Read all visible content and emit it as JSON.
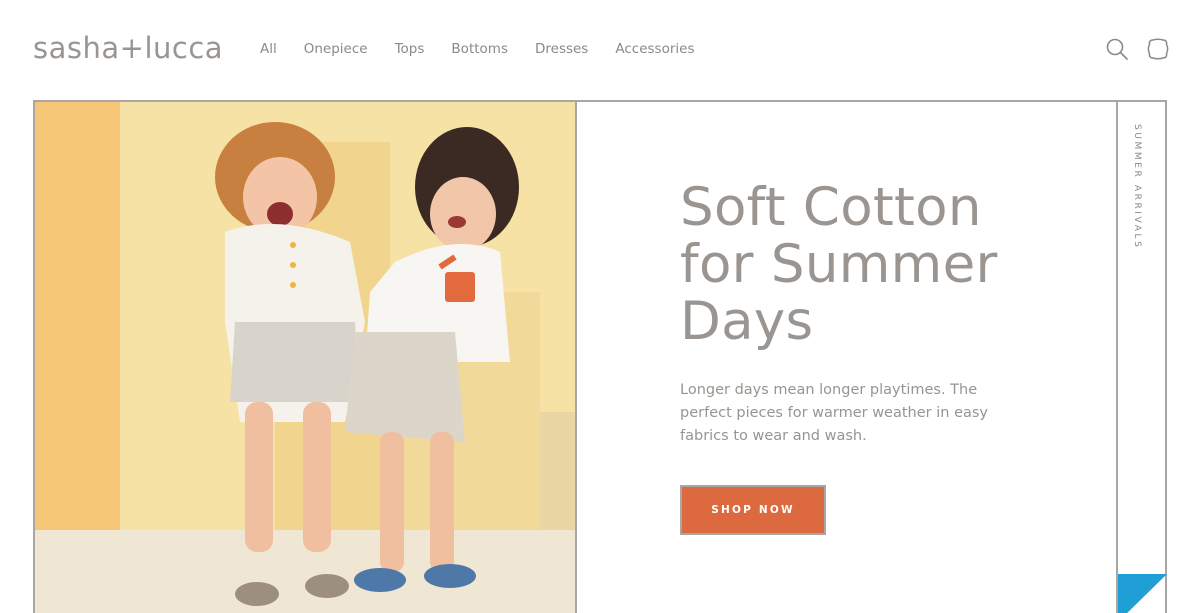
{
  "brand": {
    "logo_text": "sasha+lucca"
  },
  "nav": {
    "items": [
      "All",
      "Onepiece",
      "Tops",
      "Bottoms",
      "Dresses",
      "Accessories"
    ]
  },
  "header_icons": {
    "search": "search-icon",
    "bag": "shopping-bag-icon"
  },
  "hero": {
    "headline_lines": [
      "Soft Cotton",
      "for Summer",
      "Days"
    ],
    "body": "Longer days mean longer playtimes. The perfect pieces for warmer weather in easy fabrics to wear and wash.",
    "cta_label": "SHOP NOW",
    "side_label": "SUMMER ARRIVALS"
  },
  "colors": {
    "accent": "#dd6a3f",
    "text": "#9a9590",
    "border": "#a9a6a3",
    "corner_tab": "#1f9fd6",
    "photo_background": "#f7dd9a"
  }
}
